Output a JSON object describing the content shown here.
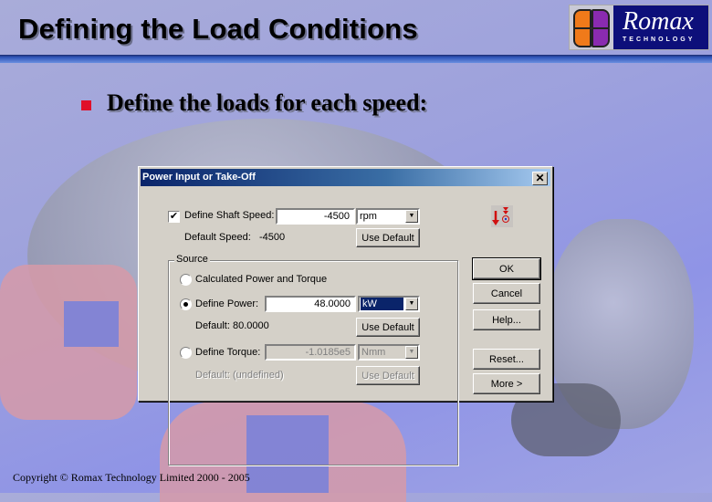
{
  "slide": {
    "title": "Defining the Load Conditions",
    "bullet": "Define the loads for each speed:",
    "copyright": "Copyright © Romax Technology Limited 2000 - 2005",
    "logo": {
      "name": "Romax",
      "tagline": "TECHNOLOGY"
    }
  },
  "dialog": {
    "title": "Power Input or Take-Off",
    "close_label": "✕",
    "shaft_speed": {
      "checkbox_label": "Define Shaft Speed:",
      "checked": true,
      "value": "-4500",
      "unit": "rpm",
      "default_label": "Default Speed:",
      "default_value": "-4500",
      "use_default": "Use Default"
    },
    "source": {
      "label": "Source",
      "calculated_label": "Calculated Power and Torque",
      "power": {
        "label": "Define Power:",
        "selected": true,
        "value": "48.0000",
        "unit": "kW",
        "default_text": "Default:  80.0000",
        "use_default": "Use Default"
      },
      "torque": {
        "label": "Define Torque:",
        "selected": false,
        "value": "-1.0185e5",
        "unit": "Nmm",
        "default_text": "Default:  (undefined)",
        "use_default": "Use Default"
      }
    },
    "buttons": {
      "ok": "OK",
      "cancel": "Cancel",
      "help": "Help...",
      "reset": "Reset...",
      "more": "More >"
    }
  }
}
